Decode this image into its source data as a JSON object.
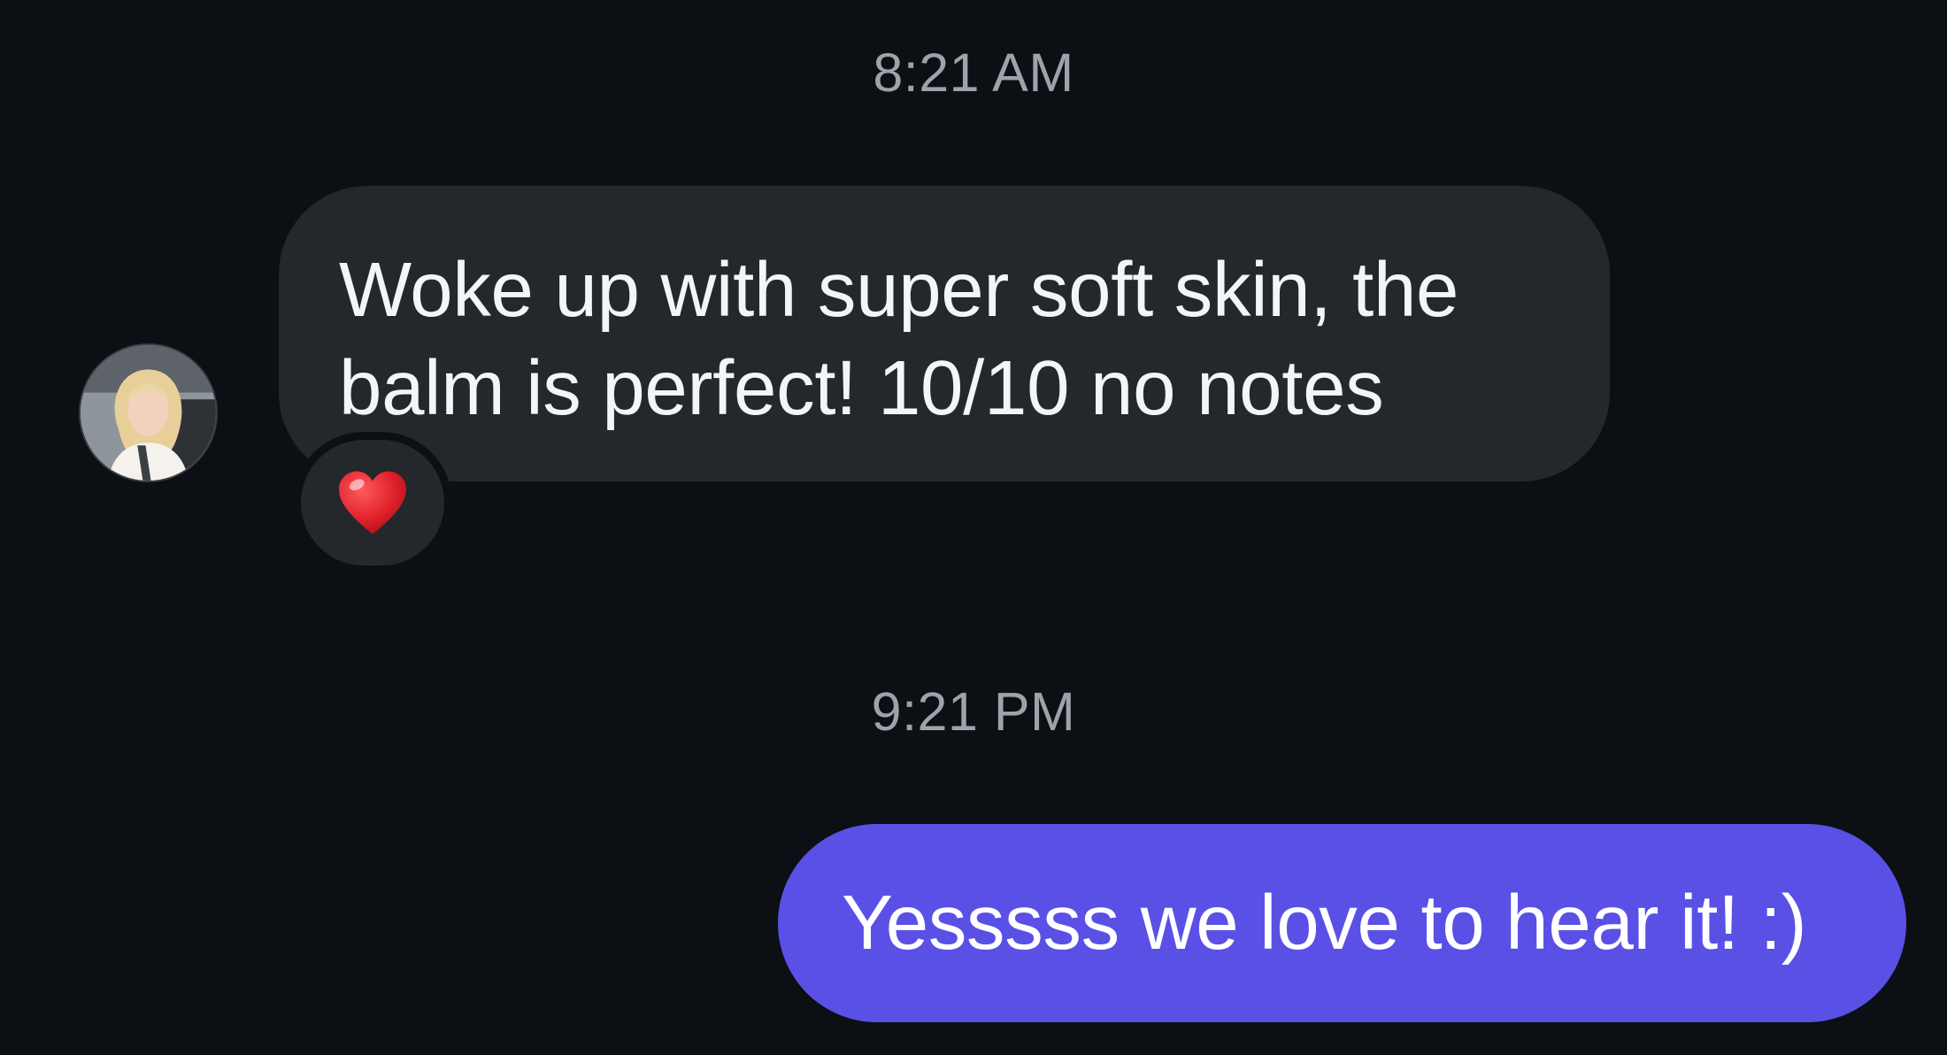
{
  "messages": {
    "timestamp_1": "8:21 AM",
    "incoming": {
      "text": "Woke up with super soft skin, the balm is perfect! 10/10 no notes",
      "reaction_icon": "heart-emoji",
      "reaction_color": "#e0202a"
    },
    "timestamp_2": "9:21 PM",
    "outgoing": {
      "text": "Yesssss we love to hear it! :)"
    }
  },
  "colors": {
    "background": "#0c0f14",
    "incoming_bubble": "#24272c",
    "outgoing_bubble": "#5a50e6",
    "timestamp": "#9ea3aa"
  }
}
